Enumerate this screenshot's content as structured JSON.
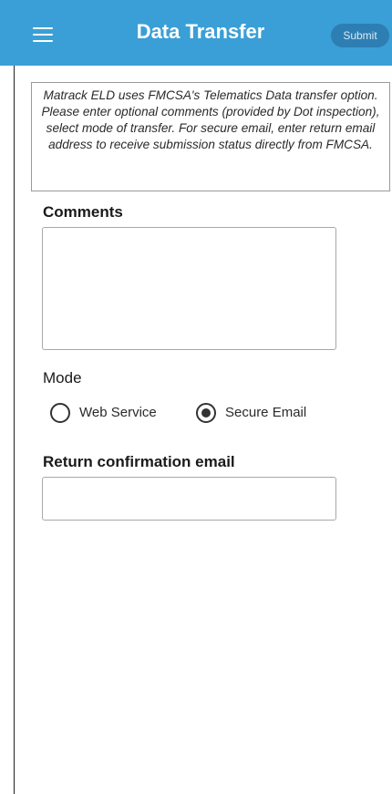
{
  "header": {
    "title": "Data Transfer",
    "submit_label": "Submit",
    "menu_icon": "hamburger-menu-icon",
    "background_color": "#3a9fd6"
  },
  "info": {
    "text": "Matrack ELD uses FMCSA's Telematics Data transfer option. Please enter optional comments (provided by Dot inspection), select mode of transfer. For secure email, enter return email address to receive submission status directly from FMCSA."
  },
  "comments": {
    "label": "Comments",
    "value": "",
    "placeholder": ""
  },
  "mode": {
    "label": "Mode",
    "options": [
      {
        "label": "Web Service",
        "selected": false
      },
      {
        "label": "Secure Email",
        "selected": true
      }
    ]
  },
  "email": {
    "label": "Return confirmation email",
    "value": "",
    "placeholder": ""
  }
}
